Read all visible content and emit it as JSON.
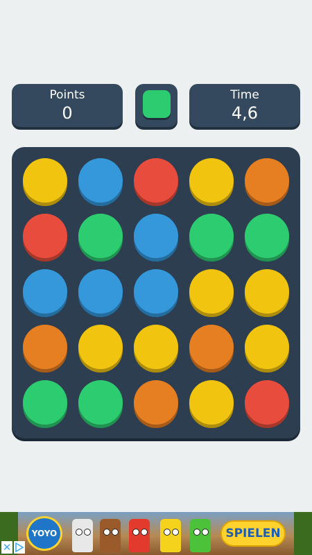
{
  "hud": {
    "points_label": "Points",
    "points_value": "0",
    "time_label": "Time",
    "time_value": "4,6",
    "target_color": "#2ecc71"
  },
  "palette": {
    "yellow": "#f1c40f",
    "blue": "#3498db",
    "red": "#e74c3c",
    "orange": "#e67e22",
    "green": "#2ecc71"
  },
  "grid": [
    [
      "yellow",
      "blue",
      "red",
      "yellow",
      "orange"
    ],
    [
      "red",
      "green",
      "blue",
      "green",
      "green"
    ],
    [
      "blue",
      "blue",
      "blue",
      "yellow",
      "yellow"
    ],
    [
      "orange",
      "yellow",
      "yellow",
      "orange",
      "yellow"
    ],
    [
      "green",
      "green",
      "orange",
      "yellow",
      "red"
    ]
  ],
  "ad": {
    "logo_text": "YOYO",
    "cta_label": "SPIELEN",
    "close_icon": "close-icon",
    "info_icon": "adchoices-icon"
  }
}
